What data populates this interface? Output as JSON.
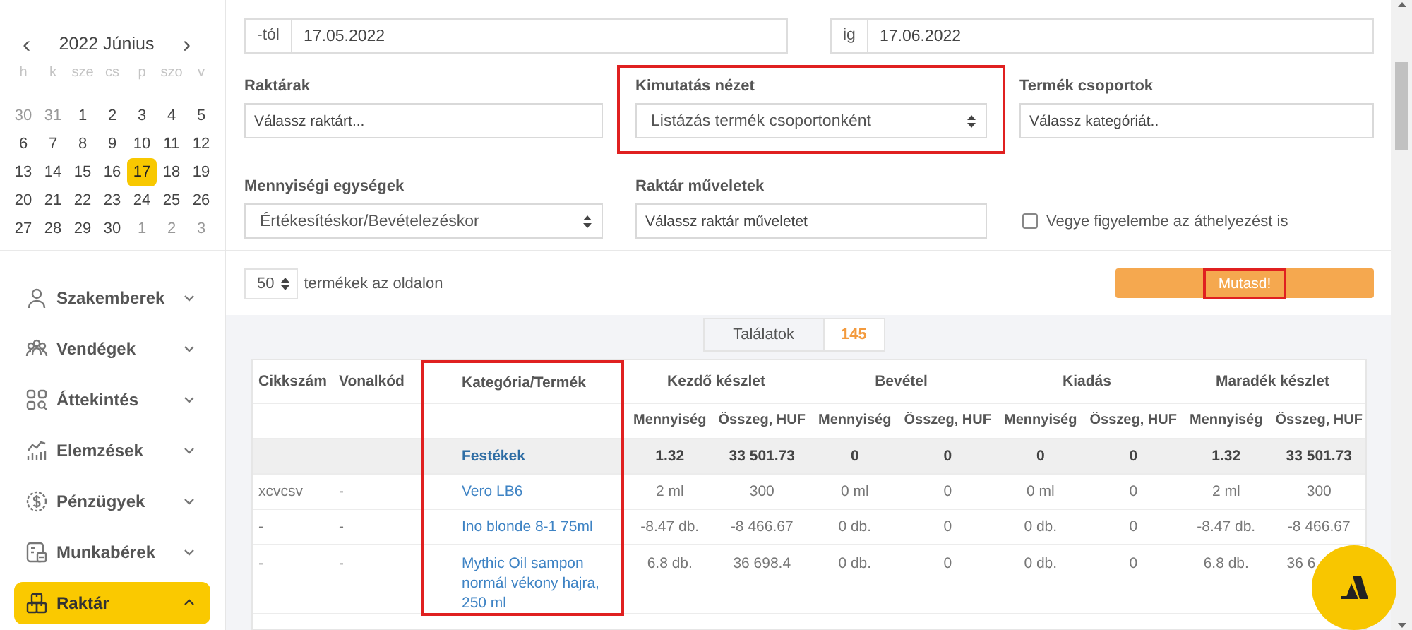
{
  "calendar": {
    "prev_button": "‹",
    "title": "2022 Június",
    "next_button": "›",
    "weekdays": [
      "h",
      "k",
      "sze",
      "cs",
      "p",
      "szo",
      "v"
    ],
    "weeks": [
      [
        {
          "day": "30",
          "muted": true,
          "selected": false
        },
        {
          "day": "31",
          "muted": true,
          "selected": false
        },
        {
          "day": "1",
          "muted": false,
          "selected": false
        },
        {
          "day": "2",
          "muted": false,
          "selected": false
        },
        {
          "day": "3",
          "muted": false,
          "selected": false
        },
        {
          "day": "4",
          "muted": false,
          "selected": false
        },
        {
          "day": "5",
          "muted": false,
          "selected": false
        }
      ],
      [
        {
          "day": "6",
          "muted": false,
          "selected": false
        },
        {
          "day": "7",
          "muted": false,
          "selected": false
        },
        {
          "day": "8",
          "muted": false,
          "selected": false
        },
        {
          "day": "9",
          "muted": false,
          "selected": false
        },
        {
          "day": "10",
          "muted": false,
          "selected": false
        },
        {
          "day": "11",
          "muted": false,
          "selected": false
        },
        {
          "day": "12",
          "muted": false,
          "selected": false
        }
      ],
      [
        {
          "day": "13",
          "muted": false,
          "selected": false
        },
        {
          "day": "14",
          "muted": false,
          "selected": false
        },
        {
          "day": "15",
          "muted": false,
          "selected": false
        },
        {
          "day": "16",
          "muted": false,
          "selected": false
        },
        {
          "day": "17",
          "muted": false,
          "selected": true
        },
        {
          "day": "18",
          "muted": false,
          "selected": false
        },
        {
          "day": "19",
          "muted": false,
          "selected": false
        }
      ],
      [
        {
          "day": "20",
          "muted": false,
          "selected": false
        },
        {
          "day": "21",
          "muted": false,
          "selected": false
        },
        {
          "day": "22",
          "muted": false,
          "selected": false
        },
        {
          "day": "23",
          "muted": false,
          "selected": false
        },
        {
          "day": "24",
          "muted": false,
          "selected": false
        },
        {
          "day": "25",
          "muted": false,
          "selected": false
        },
        {
          "day": "26",
          "muted": false,
          "selected": false
        }
      ],
      [
        {
          "day": "27",
          "muted": false,
          "selected": false
        },
        {
          "day": "28",
          "muted": false,
          "selected": false
        },
        {
          "day": "29",
          "muted": false,
          "selected": false
        },
        {
          "day": "30",
          "muted": false,
          "selected": false
        },
        {
          "day": "1",
          "muted": true,
          "selected": false
        },
        {
          "day": "2",
          "muted": true,
          "selected": false
        },
        {
          "day": "3",
          "muted": true,
          "selected": false
        }
      ]
    ]
  },
  "sidebar": {
    "items": [
      {
        "label": "Szakemberek",
        "selected": false,
        "expanded": false
      },
      {
        "label": "Vendégek",
        "selected": false,
        "expanded": false
      },
      {
        "label": "Áttekintés",
        "selected": false,
        "expanded": false
      },
      {
        "label": "Elemzések",
        "selected": false,
        "expanded": false
      },
      {
        "label": "Pénzügyek",
        "selected": false,
        "expanded": false
      },
      {
        "label": "Munkabérek",
        "selected": false,
        "expanded": false
      },
      {
        "label": "Raktár",
        "selected": true,
        "expanded": true
      }
    ]
  },
  "filters": {
    "from": {
      "label": "-tól",
      "value": "17.05.2022"
    },
    "to": {
      "label": "ig",
      "value": "17.06.2022"
    },
    "fields": [
      {
        "kind": "input",
        "label": "Raktárak",
        "placeholder": "Válassz raktárt...",
        "highlighted": false
      },
      {
        "kind": "select",
        "label": "Kimutatás nézet",
        "value": "Listázás termék csoportonként",
        "highlighted": true
      },
      {
        "kind": "input",
        "label": "Termék csoportok",
        "placeholder": "Válassz kategóriát..",
        "highlighted": false
      },
      {
        "kind": "select",
        "label": "Mennyiségi egységek",
        "value": "Értékesítéskor/Bevételezéskor",
        "highlighted": false
      },
      {
        "kind": "input",
        "label": "Raktár műveletek",
        "placeholder": "Válassz raktár műveletet",
        "highlighted": false
      },
      {
        "kind": "checkbox",
        "label": "Vegye figyelembe az áthelyezést is",
        "checked": false
      }
    ]
  },
  "page_size": {
    "value": "50",
    "label": "termékek az oldalon"
  },
  "show_button": {
    "label": "Mutasd!",
    "highlighted": true
  },
  "results": {
    "label": "Találatok",
    "count": "145"
  },
  "table": {
    "columns": [
      {
        "label": "Cikkszám",
        "highlighted": false
      },
      {
        "label": "Vonalkód",
        "highlighted": false
      },
      {
        "label": "Kategória/Termék",
        "highlighted": true
      }
    ],
    "groups": [
      {
        "label": "Kezdő készlet",
        "subcolumns": [
          "Mennyiség",
          "Összeg, HUF"
        ]
      },
      {
        "label": "Bevétel",
        "subcolumns": [
          "Mennyiség",
          "Összeg, HUF"
        ]
      },
      {
        "label": "Kiadás",
        "subcolumns": [
          "Mennyiség",
          "Összeg, HUF"
        ]
      },
      {
        "label": "Maradék készlet",
        "subcolumns": [
          "Mennyiség",
          "Összeg, HUF"
        ]
      }
    ],
    "rows": [
      {
        "kind": "category",
        "name": "Festékek",
        "values": [
          "1.32",
          "33 501.73",
          "0",
          "0",
          "0",
          "0",
          "1.32",
          "33 501.73"
        ]
      },
      {
        "kind": "product",
        "code": "xcvcsv",
        "barcode": "-",
        "name": "Vero LB6",
        "values": [
          "2 ml",
          "300",
          "0 ml",
          "0",
          "0 ml",
          "0",
          "2 ml",
          "300"
        ]
      },
      {
        "kind": "product",
        "code": "-",
        "barcode": "-",
        "name": "Ino blonde 8-1 75ml",
        "values": [
          "-8.47 db.",
          "-8 466.67",
          "0 db.",
          "0",
          "0 db.",
          "0",
          "-8.47 db.",
          "-8 466.67"
        ]
      },
      {
        "kind": "product",
        "code": "-",
        "barcode": "-",
        "name": "Mythic Oil sampon normál vékony hajra, 250 ml",
        "values": [
          "6.8 db.",
          "36 698.4",
          "0 db.",
          "0",
          "0 db.",
          "0",
          "6.8 db.",
          "36 6"
        ]
      }
    ]
  }
}
